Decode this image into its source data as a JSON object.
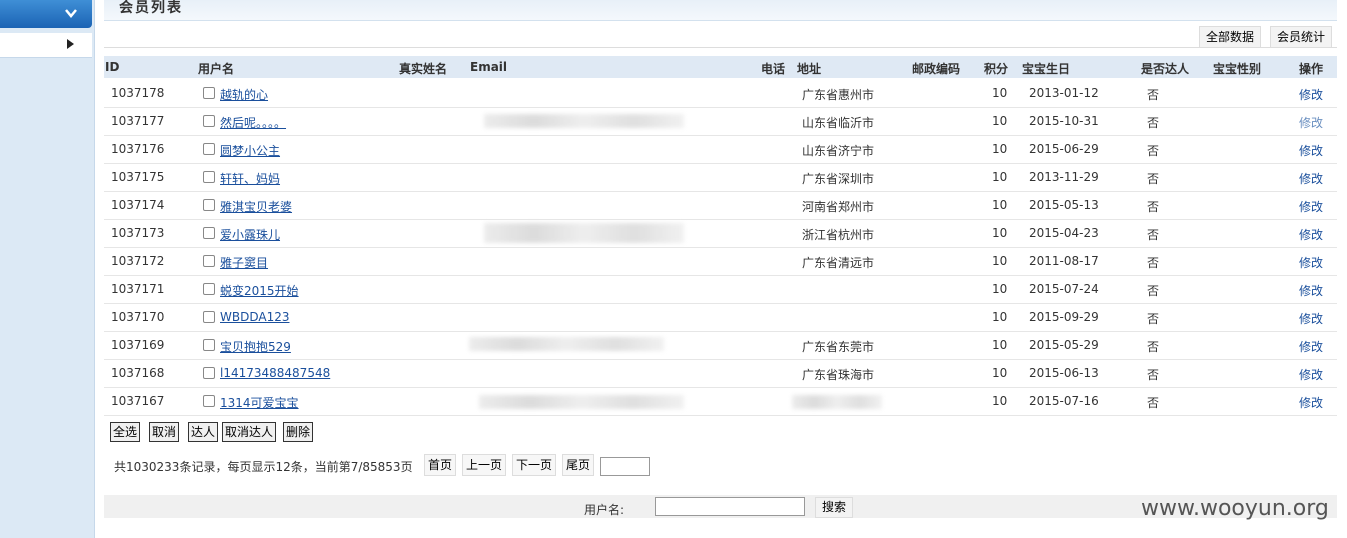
{
  "page": {
    "title": "会员列表"
  },
  "toolbar": {
    "all_data": "全部数据",
    "member_stats": "会员统计"
  },
  "table": {
    "headers": {
      "id": "ID",
      "username": "用户名",
      "realname": "真实姓名",
      "email": "Email",
      "phone": "电话",
      "address": "地址",
      "postcode": "邮政编码",
      "points": "积分",
      "baby_birthday": "宝宝生日",
      "is_expert": "是否达人",
      "baby_gender": "宝宝性别",
      "actions": "操作"
    },
    "rows": [
      {
        "id": "1037178",
        "username": "越轨的心",
        "address": "广东省惠州市",
        "points": "10",
        "birthday": "2013-01-12",
        "expert": "否",
        "edit": "修改"
      },
      {
        "id": "1037177",
        "username": "然后呢。。。。",
        "address": "山东省临沂市",
        "points": "10",
        "birthday": "2015-10-31",
        "expert": "否",
        "edit": "修改"
      },
      {
        "id": "1037176",
        "username": "圆梦小公主",
        "address": "山东省济宁市",
        "points": "10",
        "birthday": "2015-06-29",
        "expert": "否",
        "edit": "修改"
      },
      {
        "id": "1037175",
        "username": "轩轩、妈妈",
        "address": "广东省深圳市",
        "points": "10",
        "birthday": "2013-11-29",
        "expert": "否",
        "edit": "修改"
      },
      {
        "id": "1037174",
        "username": "雅淇宝贝老婆",
        "address": "河南省郑州市",
        "points": "10",
        "birthday": "2015-05-13",
        "expert": "否",
        "edit": "修改"
      },
      {
        "id": "1037173",
        "username": "爱小露珠儿",
        "address": "浙江省杭州市",
        "points": "10",
        "birthday": "2015-04-23",
        "expert": "否",
        "edit": "修改"
      },
      {
        "id": "1037172",
        "username": "雅子窦目",
        "address": "广东省清远市",
        "points": "10",
        "birthday": "2011-08-17",
        "expert": "否",
        "edit": "修改"
      },
      {
        "id": "1037171",
        "username": "蜕变2015开始",
        "address": "",
        "points": "10",
        "birthday": "2015-07-24",
        "expert": "否",
        "edit": "修改"
      },
      {
        "id": "1037170",
        "username": "WBDDA123",
        "address": "",
        "points": "10",
        "birthday": "2015-09-29",
        "expert": "否",
        "edit": "修改"
      },
      {
        "id": "1037169",
        "username": "宝贝抱抱529",
        "address": "广东省东莞市",
        "points": "10",
        "birthday": "2015-05-29",
        "expert": "否",
        "edit": "修改"
      },
      {
        "id": "1037168",
        "username": "l14173488487548",
        "address": "广东省珠海市",
        "points": "10",
        "birthday": "2015-06-13",
        "expert": "否",
        "edit": "修改"
      },
      {
        "id": "1037167",
        "username": "1314可爱宝宝",
        "address": "",
        "points": "10",
        "birthday": "2015-07-16",
        "expert": "否",
        "edit": "修改"
      }
    ]
  },
  "bulk_actions": {
    "select_all": "全选",
    "cancel": "取消",
    "expert": "达人",
    "cancel_expert": "取消达人",
    "delete": "删除"
  },
  "pager": {
    "summary": "共1030233条记录，每页显示12条，当前第7/85853页",
    "first": "首页",
    "prev": "上一页",
    "next": "下一页",
    "last": "尾页"
  },
  "search": {
    "label": "用户名:",
    "button": "搜索"
  },
  "watermark": "www.wooyun.org"
}
